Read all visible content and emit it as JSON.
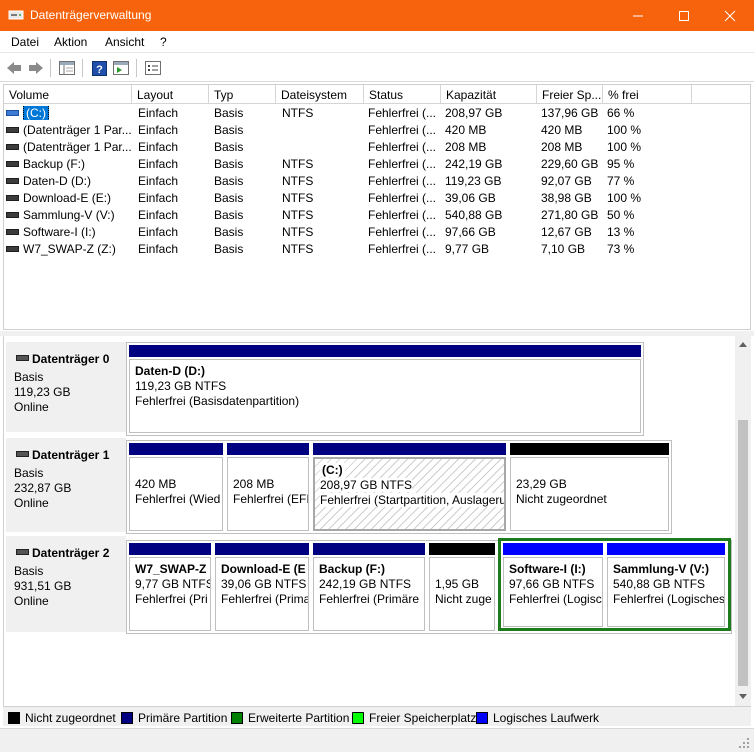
{
  "window": {
    "title": "Datenträgerverwaltung"
  },
  "menu": [
    {
      "label": "Datei"
    },
    {
      "label": "Aktion"
    },
    {
      "label": "Ansicht"
    },
    {
      "label": "?"
    }
  ],
  "list": {
    "headers": [
      "Volume",
      "Layout",
      "Typ",
      "Dateisystem",
      "Status",
      "Kapazität",
      "Freier Sp...",
      "% frei"
    ],
    "rows": [
      [
        "(C:)",
        "Einfach",
        "Basis",
        "NTFS",
        "Fehlerfrei (...",
        "208,97 GB",
        "137,96 GB",
        "66 %"
      ],
      [
        "(Datenträger 1 Par...",
        "Einfach",
        "Basis",
        "",
        "Fehlerfrei (...",
        "420 MB",
        "420 MB",
        "100 %"
      ],
      [
        "(Datenträger 1 Par...",
        "Einfach",
        "Basis",
        "",
        "Fehlerfrei (...",
        "208 MB",
        "208 MB",
        "100 %"
      ],
      [
        "Backup (F:)",
        "Einfach",
        "Basis",
        "NTFS",
        "Fehlerfrei (...",
        "242,19 GB",
        "229,60 GB",
        "95 %"
      ],
      [
        "Daten-D (D:)",
        "Einfach",
        "Basis",
        "NTFS",
        "Fehlerfrei (...",
        "119,23 GB",
        "92,07 GB",
        "77 %"
      ],
      [
        "Download-E (E:)",
        "Einfach",
        "Basis",
        "NTFS",
        "Fehlerfrei (...",
        "39,06 GB",
        "38,98 GB",
        "100 %"
      ],
      [
        "Sammlung-V (V:)",
        "Einfach",
        "Basis",
        "NTFS",
        "Fehlerfrei (...",
        "540,88 GB",
        "271,80 GB",
        "50 %"
      ],
      [
        "Software-I (I:)",
        "Einfach",
        "Basis",
        "NTFS",
        "Fehlerfrei (...",
        "97,66 GB",
        "12,67 GB",
        "13 %"
      ],
      [
        "W7_SWAP-Z (Z:)",
        "Einfach",
        "Basis",
        "NTFS",
        "Fehlerfrei (...",
        "9,77 GB",
        "7,10 GB",
        "73 %"
      ]
    ]
  },
  "disks": [
    {
      "name": "Datenträger 0",
      "type": "Basis",
      "size": "119,23 GB",
      "state": "Online",
      "partitions": [
        {
          "name": "Daten-D  (D:)",
          "size": "119,23 GB NTFS",
          "status": "Fehlerfrei (Basisdatenpartition)",
          "kind": "primary"
        }
      ]
    },
    {
      "name": "Datenträger 1",
      "type": "Basis",
      "size": "232,87 GB",
      "state": "Online",
      "partitions": [
        {
          "name": "",
          "size": "420 MB",
          "status": "Fehlerfrei (Wied",
          "kind": "primary"
        },
        {
          "name": "",
          "size": "208 MB",
          "status": "Fehlerfrei (EFI",
          "kind": "primary"
        },
        {
          "name": "(C:)",
          "size": "208,97 GB NTFS",
          "status": "Fehlerfrei (Startpartition, Auslagerun",
          "kind": "primary",
          "selected": true
        },
        {
          "name": "",
          "size": "23,29 GB",
          "status": "Nicht zugeordnet",
          "kind": "unallocated"
        }
      ]
    },
    {
      "name": "Datenträger 2",
      "type": "Basis",
      "size": "931,51 GB",
      "state": "Online",
      "partitions": [
        {
          "name": "W7_SWAP-Z",
          "size": "9,77 GB NTFS",
          "status": "Fehlerfrei (Pri",
          "kind": "primary"
        },
        {
          "name": "Download-E  (E",
          "size": "39,06 GB NTFS",
          "status": "Fehlerfrei (Prima",
          "kind": "primary"
        },
        {
          "name": "Backup  (F:)",
          "size": "242,19 GB NTFS",
          "status": "Fehlerfrei (Primäre",
          "kind": "primary"
        },
        {
          "name": "",
          "size": "1,95 GB",
          "status": "Nicht zuge",
          "kind": "unallocated"
        },
        {
          "name": "Software-I  (I:)",
          "size": "97,66 GB NTFS",
          "status": "Fehlerfrei (Logisc",
          "kind": "logical"
        },
        {
          "name": "Sammlung-V  (V:)",
          "size": "540,88 GB NTFS",
          "status": "Fehlerfrei (Logisches",
          "kind": "logical"
        }
      ]
    }
  ],
  "legend": [
    {
      "label": "Nicht zugeordnet",
      "color": "#000000"
    },
    {
      "label": "Primäre Partition",
      "color": "#000080"
    },
    {
      "label": "Erweiterte Partition",
      "color": "#008000"
    },
    {
      "label": "Freier Speicherplatz",
      "color": "#00ff00"
    },
    {
      "label": "Logisches Laufwerk",
      "color": "#0000ff"
    }
  ],
  "colors": {
    "titlebar": "#f7630c",
    "primary": "#000080",
    "unallocated": "#000000",
    "logical": "#0000ff",
    "extended": "#1d7a1d"
  }
}
